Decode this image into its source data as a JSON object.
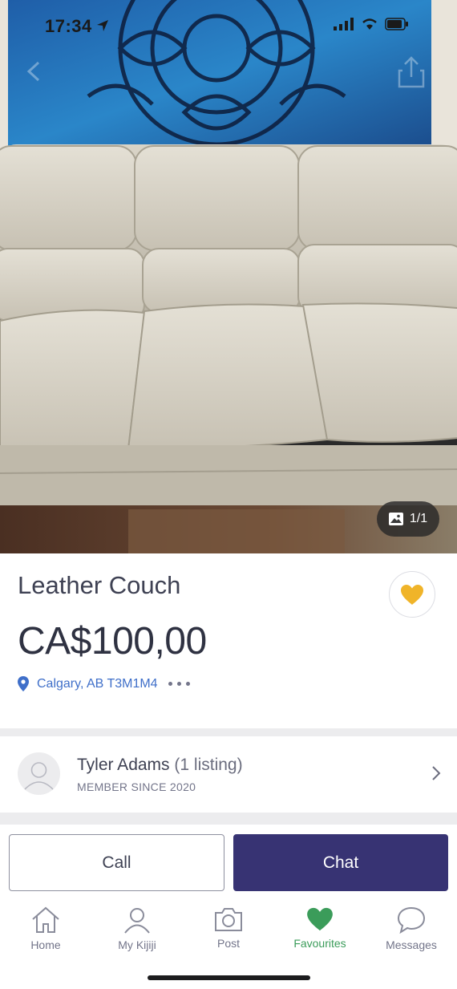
{
  "status_bar": {
    "time": "17:34"
  },
  "photo": {
    "counter": "1/1"
  },
  "listing": {
    "title": "Leather Couch",
    "price": "CA$100,00",
    "location": "Calgary, AB T3M1M4",
    "favourited": true
  },
  "seller": {
    "name": "Tyler Adams",
    "listing_count": "(1 listing)",
    "member_since": "MEMBER SINCE 2020"
  },
  "actions": {
    "call_label": "Call",
    "chat_label": "Chat"
  },
  "tabs": [
    {
      "label": "Home",
      "icon": "home-icon"
    },
    {
      "label": "My Kijiji",
      "icon": "person-icon"
    },
    {
      "label": "Post",
      "icon": "camera-icon"
    },
    {
      "label": "Favourites",
      "icon": "heart-icon",
      "active": true
    },
    {
      "label": "Messages",
      "icon": "chat-bubble-icon"
    }
  ],
  "colors": {
    "brand_primary": "#373373",
    "active_tab": "#3b9c5a",
    "favourite_heart": "#f0b429",
    "link_blue": "#3f6fc9"
  }
}
